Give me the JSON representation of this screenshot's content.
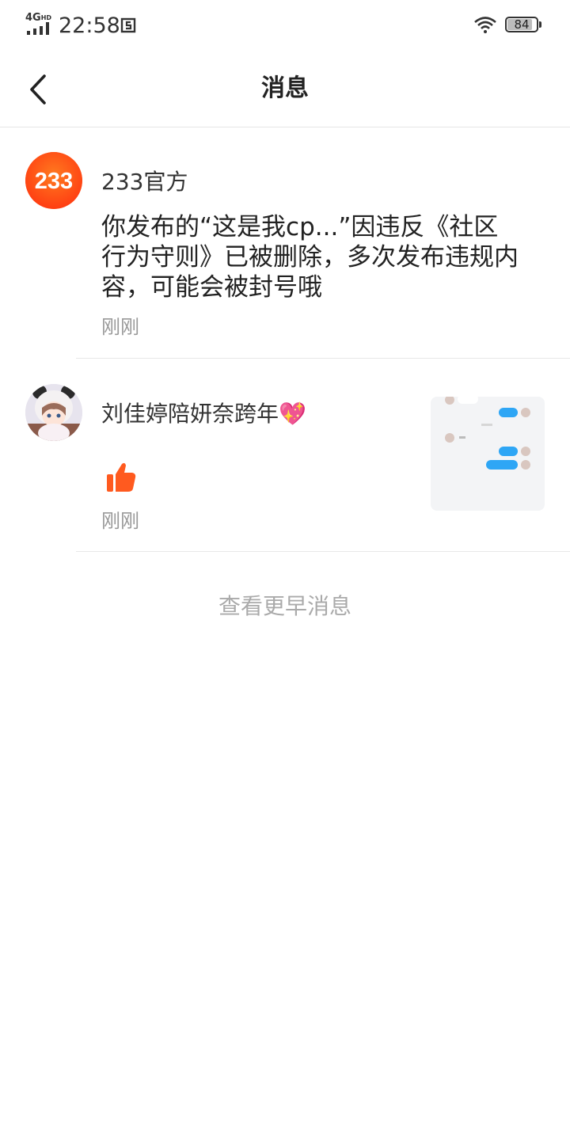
{
  "status_bar": {
    "network": "4G",
    "network_suffix": "HD",
    "time": "22:58",
    "battery": "84",
    "icons": [
      "signal-icon",
      "sim-icon",
      "wifi-icon",
      "battery-icon"
    ]
  },
  "header": {
    "title": "消息",
    "back_icon": "chevron-left-icon"
  },
  "messages": [
    {
      "avatar_text": "233",
      "sender": "233官方",
      "body": "你发布的“这是我cp...”因违反《社区行为守则》已被删除，多次发布违规内容，可能会被封号哦",
      "time": "刚刚"
    },
    {
      "sender": "刘佳婷陪妍奈跨年💖",
      "action_icon": "thumbs-up-icon",
      "time": "刚刚"
    }
  ],
  "footer": {
    "more_label": "查看更早消息"
  },
  "colors": {
    "brand_orange": "#ff5a1f",
    "chat_bubble_blue": "#2ea6f5",
    "divider": "#e8e8e8",
    "muted_text": "#999999"
  }
}
